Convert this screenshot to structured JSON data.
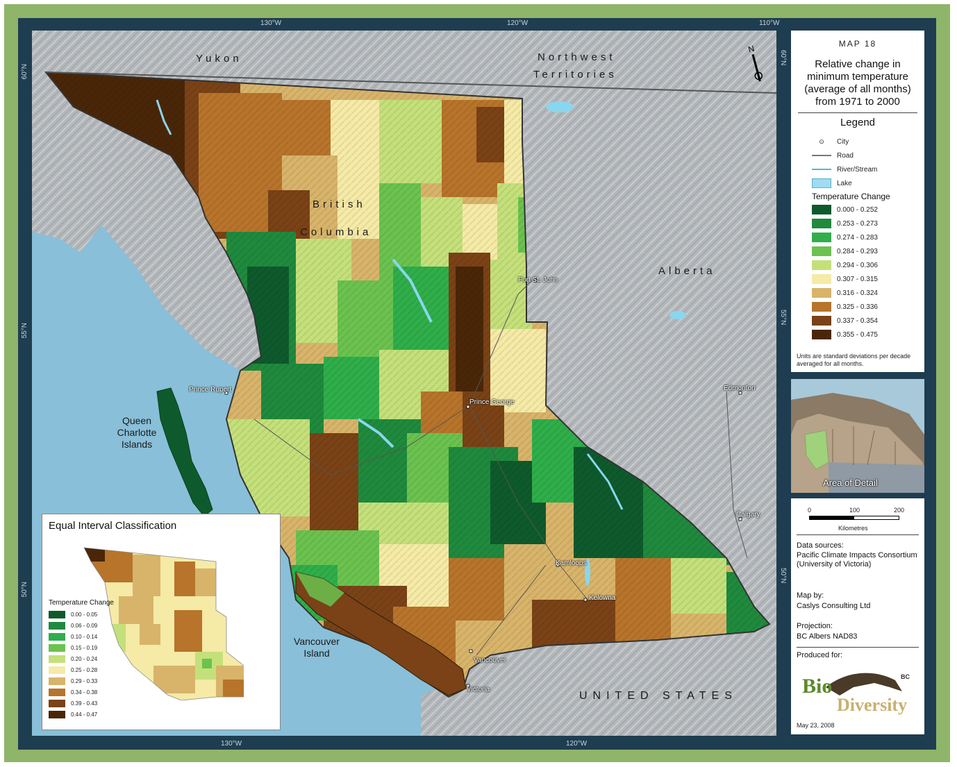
{
  "map": {
    "graticule": {
      "top": [
        "130°W",
        "120°W",
        "110°W"
      ],
      "bottom": [
        "130°W",
        "120°W"
      ],
      "left": [
        "60°N",
        "55°N",
        "50°N"
      ],
      "right": [
        "60°N",
        "55°N",
        "50°N"
      ]
    },
    "regions": {
      "yukon": "Yukon",
      "nwt_line1": "Northwest",
      "nwt_line2": "Territories",
      "bc_line1": "British",
      "bc_line2": "Columbia",
      "alberta": "Alberta",
      "us": "UNITED STATES"
    },
    "islands": {
      "qci": "Queen\nCharlotte\nIslands",
      "vi": "Vancouver\nIsland"
    },
    "cities": [
      "Fort St. John",
      "Prince Rupert",
      "Prince George",
      "Edmonton",
      "Calgary",
      "Kamloops",
      "Kelowna",
      "Vancouver",
      "Victoria"
    ],
    "colors": {
      "c1": "#0e5a2c",
      "c2": "#1f8a3d",
      "c3": "#2fae4a",
      "c4": "#6bc24f",
      "c5": "#c4e07a",
      "c6": "#f5eaa6",
      "c7": "#d8b46a",
      "c8": "#b7742a",
      "c9": "#7a4216",
      "c10": "#4a2608",
      "ocean": "#8fc3dc",
      "land_gray": "#b3b7ba",
      "water": "#8ad6ee"
    }
  },
  "legend_panel": {
    "map_number": "MAP 18",
    "title": "Relative change in minimum temperature (average of all months) from 1971 to 2000",
    "legend_heading": "Legend",
    "items": [
      {
        "label": "City",
        "icon": "city-icon"
      },
      {
        "label": "Road",
        "icon": "road-icon"
      },
      {
        "label": "River/Stream",
        "icon": "river-icon"
      },
      {
        "label": "Lake",
        "icon": "lake-icon"
      }
    ],
    "temp_heading": "Temperature Change",
    "classes": [
      {
        "range": "0.000 - 0.252",
        "color": "#0e5a2c"
      },
      {
        "range": "0.253 - 0.273",
        "color": "#1f8a3d"
      },
      {
        "range": "0.274 - 0.283",
        "color": "#2fae4a"
      },
      {
        "range": "0.284 - 0.293",
        "color": "#6bc24f"
      },
      {
        "range": "0.294 - 0.306",
        "color": "#c4e07a"
      },
      {
        "range": "0.307 - 0.315",
        "color": "#f5eaa6"
      },
      {
        "range": "0.316 - 0.324",
        "color": "#d8b46a"
      },
      {
        "range": "0.325 - 0.336",
        "color": "#b7742a"
      },
      {
        "range": "0.337 - 0.354",
        "color": "#7a4216"
      },
      {
        "range": "0.355 - 0.475",
        "color": "#4a2608"
      }
    ],
    "units_note": "Units are standard deviations per decade averaged for all months."
  },
  "locator": {
    "label": "Area of Detail"
  },
  "scale": {
    "ticks": [
      "0",
      "100",
      "200"
    ],
    "unit": "Kilometres"
  },
  "credits": {
    "data_heading": "Data sources:",
    "data_value": "Pacific Climate Impacts Consortium (University of Victoria)",
    "mapby_heading": "Map by:",
    "mapby_value": "Caslys Consulting Ltd",
    "proj_heading": "Projection:",
    "proj_value": "BC Albers NAD83",
    "produced_heading": "Produced for:",
    "logo_text": "BioDiversity",
    "date": "May 23, 2008"
  },
  "inset_panel": {
    "title": "Equal Interval Classification",
    "temp_heading": "Temperature Change",
    "classes": [
      {
        "range": "0.00 - 0.05",
        "color": "#0e5a2c"
      },
      {
        "range": "0.06 - 0.09",
        "color": "#1f8a3d"
      },
      {
        "range": "0.10 - 0.14",
        "color": "#2fae4a"
      },
      {
        "range": "0.15 - 0.19",
        "color": "#6bc24f"
      },
      {
        "range": "0.20 - 0.24",
        "color": "#c4e07a"
      },
      {
        "range": "0.25 - 0.28",
        "color": "#f5eaa6"
      },
      {
        "range": "0.29 - 0.33",
        "color": "#d8b46a"
      },
      {
        "range": "0.34 - 0.38",
        "color": "#b7742a"
      },
      {
        "range": "0.39 - 0.43",
        "color": "#7a4216"
      },
      {
        "range": "0.44 - 0.47",
        "color": "#4a2608"
      }
    ]
  }
}
